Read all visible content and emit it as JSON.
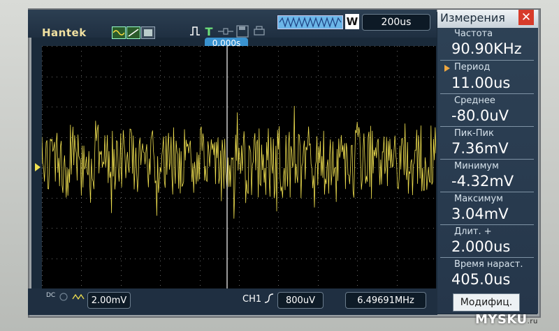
{
  "toolbar": {
    "brand": "Hantek",
    "timebase": "200us",
    "wave_mode": "W",
    "trigger_position": "0.000s"
  },
  "measurements": {
    "title": "Измерения",
    "close": "✕",
    "items": [
      {
        "label": "Частота",
        "value": "90.90KHz"
      },
      {
        "label": "Период",
        "value": "11.00us"
      },
      {
        "label": "Среднее",
        "value": "-80.0uV"
      },
      {
        "label": "Пик-Пик",
        "value": "7.36mV"
      },
      {
        "label": "Минимум",
        "value": "-4.32mV"
      },
      {
        "label": "Максимум",
        "value": "3.04mV"
      },
      {
        "label": "Длит. +",
        "value": "2.000us"
      },
      {
        "label": "Время нараст.",
        "value": "405.0us"
      }
    ],
    "modify_button": "Модифиц."
  },
  "bottom": {
    "coupling": "DC",
    "volts_div": "2.00mV",
    "channel": "CH1",
    "trigger_level": "800uV",
    "freq_counter": "6.49691MHz"
  },
  "watermark": {
    "text": "MYSKU",
    "suffix": ".ru"
  },
  "colors": {
    "trace": "#f0e050",
    "accent": "#3a93d0",
    "panel": "#2e4256"
  }
}
